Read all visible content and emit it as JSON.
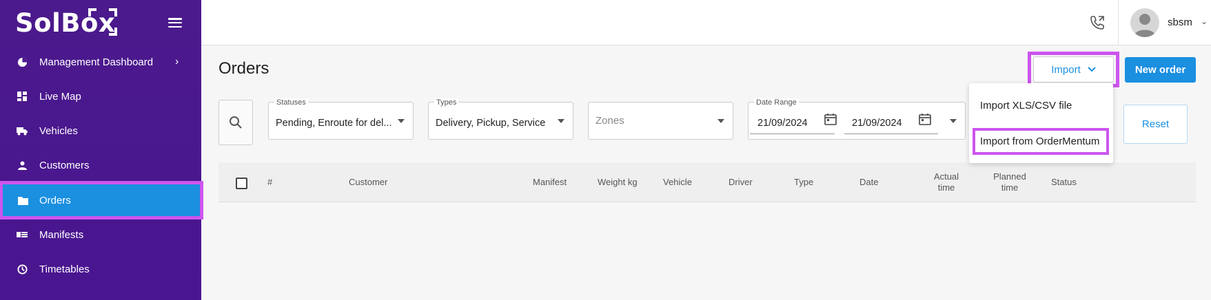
{
  "brand": {
    "name": "SolBox"
  },
  "colors": {
    "sidebar": "#4b1a8c",
    "accent": "#1b8fe0",
    "highlight": "#cc55ee"
  },
  "sidebar": {
    "items": [
      {
        "label": "Management Dashboard",
        "icon": "pie-chart-icon",
        "has_chevron": true
      },
      {
        "label": "Live Map",
        "icon": "dashboard-icon"
      },
      {
        "label": "Vehicles",
        "icon": "truck-icon"
      },
      {
        "label": "Customers",
        "icon": "person-icon"
      },
      {
        "label": "Orders",
        "icon": "folder-icon",
        "active": true
      },
      {
        "label": "Manifests",
        "icon": "list-card-icon"
      },
      {
        "label": "Timetables",
        "icon": "clock-icon"
      }
    ]
  },
  "topbar": {
    "username": "sbsm"
  },
  "page": {
    "title": "Orders",
    "import_label": "Import",
    "new_order_label": "New order",
    "reset_label": "Reset"
  },
  "filters": {
    "statuses": {
      "label": "Statuses",
      "value": "Pending, Enroute for del..."
    },
    "types": {
      "label": "Types",
      "value": "Delivery, Pickup, Service"
    },
    "zones": {
      "placeholder": "Zones"
    },
    "date_range": {
      "label": "Date Range",
      "from": "21/09/2024",
      "to": "21/09/2024"
    }
  },
  "import_menu": {
    "items": [
      "Import XLS/CSV file",
      "Import from OrderMentum"
    ]
  },
  "table": {
    "columns": [
      "#",
      "Customer",
      "Manifest",
      "Weight kg",
      "Vehicle",
      "Driver",
      "Type",
      "Date",
      "Actual time",
      "Planned time",
      "Status"
    ]
  }
}
